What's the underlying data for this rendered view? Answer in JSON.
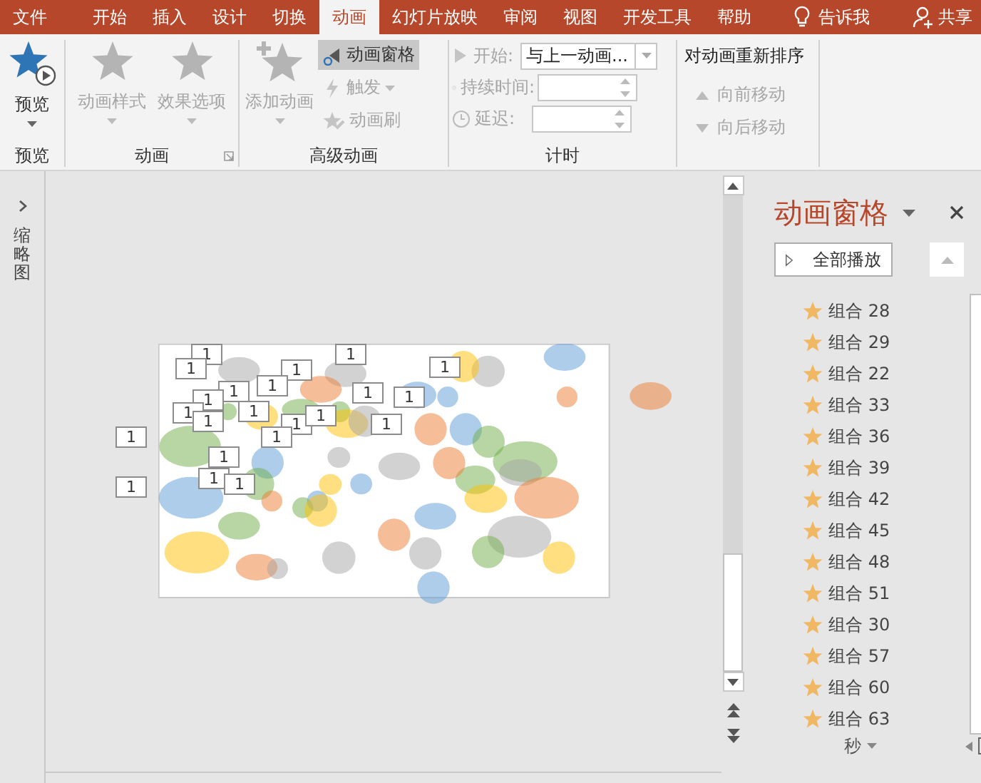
{
  "tabs": [
    {
      "label": "文件",
      "selected": false
    },
    {
      "label": "开始",
      "selected": false
    },
    {
      "label": "插入",
      "selected": false
    },
    {
      "label": "设计",
      "selected": false
    },
    {
      "label": "切换",
      "selected": false
    },
    {
      "label": "动画",
      "selected": true
    },
    {
      "label": "幻灯片放映",
      "selected": false
    },
    {
      "label": "审阅",
      "selected": false
    },
    {
      "label": "视图",
      "selected": false
    },
    {
      "label": "开发工具",
      "selected": false
    },
    {
      "label": "帮助",
      "selected": false
    }
  ],
  "tell_me": "告诉我",
  "share": "共享",
  "ribbon": {
    "preview": {
      "button": "预览",
      "group_label": "预览"
    },
    "animation": {
      "buttons": [
        {
          "label": "动画样式",
          "disabled": true
        },
        {
          "label": "效果选项",
          "disabled": true
        }
      ],
      "group_label": "动画"
    },
    "advanced": {
      "add_button": {
        "label": "添加动画",
        "disabled": true
      },
      "items": [
        {
          "label": "动画窗格",
          "selected": true,
          "disabled": false
        },
        {
          "label": "触发",
          "selected": false,
          "disabled": true
        },
        {
          "label": "动画刷",
          "selected": false,
          "disabled": true
        }
      ],
      "group_label": "高级动画"
    },
    "timing": {
      "fields": [
        {
          "kind": "dropdown",
          "label": "开始:",
          "value": "与上一动画..."
        },
        {
          "kind": "spinner",
          "label": "持续时间:"
        },
        {
          "kind": "spinner",
          "label": "延迟:"
        }
      ],
      "group_label": "计时"
    },
    "reorder": {
      "title": "对动画重新排序",
      "buttons": [
        {
          "label": "向前移动",
          "disabled": true
        },
        {
          "label": "向后移动",
          "disabled": true
        }
      ]
    }
  },
  "thumbnails": {
    "label": "缩略图"
  },
  "slide": {
    "tags": [
      "1",
      "1",
      "1",
      "1",
      "1",
      "1",
      "1",
      "1",
      "1",
      "1",
      "1",
      "1",
      "1",
      "1",
      "1",
      "1",
      "1",
      "1",
      "1",
      "1",
      "1",
      "1"
    ]
  },
  "animation_pane": {
    "title": "动画窗格",
    "play_all": "全部播放",
    "items": [
      {
        "label": "组合 28"
      },
      {
        "label": "组合 29"
      },
      {
        "label": "组合 22"
      },
      {
        "label": "组合 33"
      },
      {
        "label": "组合 36"
      },
      {
        "label": "组合 39"
      },
      {
        "label": "组合 42"
      },
      {
        "label": "组合 45"
      },
      {
        "label": "组合 48"
      },
      {
        "label": "组合 51"
      },
      {
        "label": "组合 30"
      },
      {
        "label": "组合 57"
      },
      {
        "label": "组合 60"
      },
      {
        "label": "组合 63"
      }
    ],
    "time_unit": "秒"
  }
}
